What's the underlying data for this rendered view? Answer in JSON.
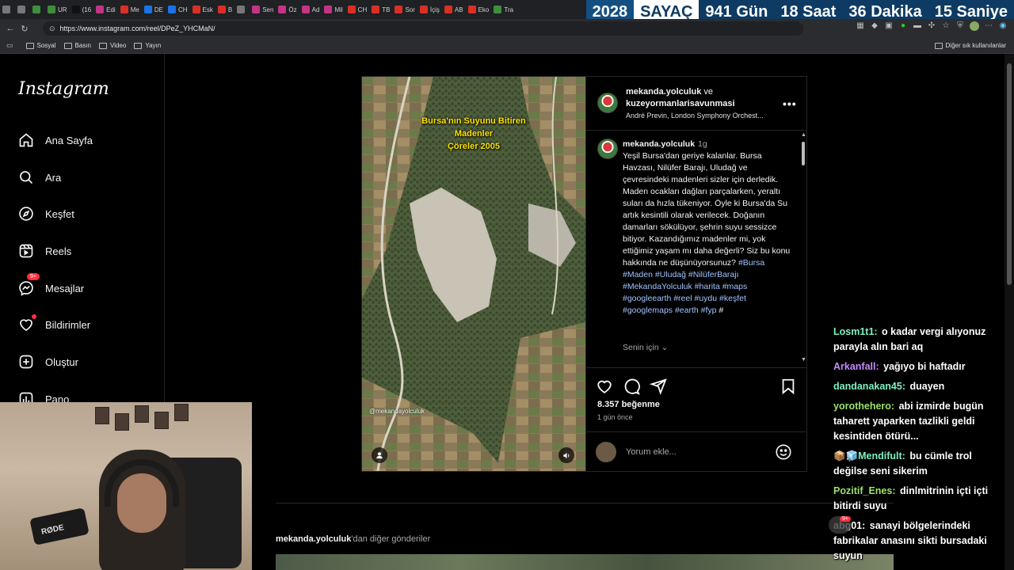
{
  "browser": {
    "tabs": [
      {
        "label": "",
        "color": "#777"
      },
      {
        "label": "",
        "color": "#777"
      },
      {
        "label": "",
        "color": "#3c8f3c"
      },
      {
        "label": "UR",
        "color": "#3c8f3c"
      },
      {
        "label": "(16",
        "color": "#111"
      },
      {
        "label": "Edi",
        "color": "#c13584"
      },
      {
        "label": "Me",
        "color": "#d93025"
      },
      {
        "label": "DE",
        "color": "#1a73e8"
      },
      {
        "label": "CH",
        "color": "#1a73e8"
      },
      {
        "label": "Esk",
        "color": "#d93025"
      },
      {
        "label": "B",
        "color": "#d93025"
      },
      {
        "label": "",
        "color": "#777"
      },
      {
        "label": "Sen",
        "color": "#c13584"
      },
      {
        "label": "Öz",
        "color": "#c13584"
      },
      {
        "label": "Ad",
        "color": "#c13584"
      },
      {
        "label": "Mil",
        "color": "#c13584"
      },
      {
        "label": "CH",
        "color": "#d93025"
      },
      {
        "label": "TB",
        "color": "#d93025"
      },
      {
        "label": "Sor",
        "color": "#d93025"
      },
      {
        "label": "İçiş",
        "color": "#d93025"
      },
      {
        "label": "AB",
        "color": "#d93025"
      },
      {
        "label": "Eko",
        "color": "#d93025"
      },
      {
        "label": "Tra",
        "color": "#3c8f3c"
      }
    ],
    "url": "https://www.instagram.com/reel/DPeZ_YHCMaN/",
    "bookmarks": [
      "Sosyal",
      "Basın",
      "Video",
      "Yayın"
    ],
    "other_bookmarks": "Diğer sık kullanılanlar"
  },
  "countdown": {
    "year": "2028",
    "label": "SAYAÇ",
    "days": "941 Gün",
    "hours": "18 Saat",
    "minutes": "36 Dakika",
    "seconds": "15 Saniye"
  },
  "sidebar": {
    "logo": "Instagram",
    "items": [
      {
        "label": "Ana Sayfa",
        "icon": "home-icon"
      },
      {
        "label": "Ara",
        "icon": "search-icon"
      },
      {
        "label": "Keşfet",
        "icon": "compass-icon"
      },
      {
        "label": "Reels",
        "icon": "reels-icon"
      },
      {
        "label": "Mesajlar",
        "icon": "messenger-icon",
        "badge": "9+"
      },
      {
        "label": "Bildirimler",
        "icon": "heart-icon"
      },
      {
        "label": "Oluştur",
        "icon": "plus-square-icon"
      },
      {
        "label": "Pano",
        "icon": "dashboard-icon"
      }
    ]
  },
  "post": {
    "media_title": [
      "Bursa'nın Suyunu Bitiren",
      "Madenler",
      "Çöreler 2005"
    ],
    "media_watermark": "@mekandayolculuk",
    "header_user1": "mekanda.yolculuk",
    "header_and": " ve",
    "header_user2": "kuzeyormanlarisavunmasi",
    "music": "André Previn, London Symphony Orchest...",
    "caption_user": "mekanda.yolculuk",
    "caption_time": "1g",
    "caption_text": "Yeşil Bursa'dan geriye kalanlar. Bursa Havzası, Nilüfer Barajı, Uludağ ve çevresindeki madenleri sizler için derledik. Maden ocakları dağları parçalarken, yeraltı suları da hızla tükeniyor. Öyle ki Bursa'da Su artık kesintili olarak verilecek. Doğanın damarları sökülüyor, şehrin suyu sessizce bitiyor. Kazandığımız madenler mi, yok ettiğimiz yaşam mı daha değerli? Siz bu konu hakkında ne düşünüyorsunuz?",
    "hashtags": "#Bursa #Maden #Uludağ #NilüferBarajı #MekandaYolculuk #harita #maps #googleearth #reel #uydu #keşfet #googlemaps #earth #fyp",
    "hashtag_tail": " #",
    "translate": "Senin için",
    "likes": "8.357 beğenme",
    "time_ago": "1 gün önce",
    "comment_placeholder": "Yorum ekle..."
  },
  "more_posts": {
    "user": "mekanda.yolculuk",
    "suffix": "'dan diğer gönderiler"
  },
  "webcam": {
    "mic_brand": "RØDE"
  },
  "chat": [
    {
      "user": "Losm1t1:",
      "color": "#7ff0c0",
      "msg": " o kadar vergi alıyonuz parayla alın bari aq"
    },
    {
      "user": "Arkanfall:",
      "color": "#c58cff",
      "msg": " yağıyo bi haftadır"
    },
    {
      "user": "dandanakan45:",
      "color": "#7ff0c0",
      "msg": " duayen"
    },
    {
      "user": "yorothehero:",
      "color": "#9be36b",
      "msg": " abi izmirde bugün taharett yaparken tazlikli geldi kesintiden ötürü..."
    },
    {
      "user": "Mendifult:",
      "color": "#7ff0c0",
      "msg": " bu cümle trol değilse seni sikerim",
      "emote": "📦🧊"
    },
    {
      "user": "Pozitif_Enes:",
      "color": "#9be36b",
      "msg": " dinlmitrinin içti içti bitirdi suyu"
    },
    {
      "user": "abg01:",
      "color": "#fff",
      "msg": " sanayi bölgelerindeki fabrikalar anasını sikti bursadaki suyun"
    }
  ],
  "chat_sticker_badge": "9+"
}
